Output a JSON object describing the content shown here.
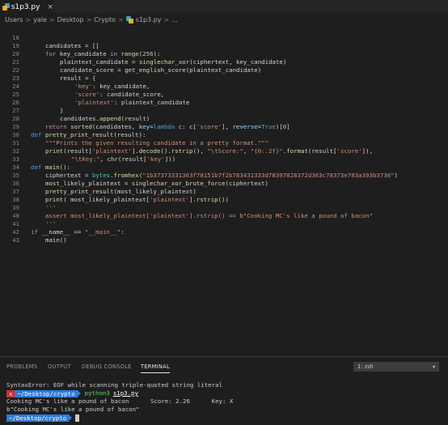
{
  "tab": {
    "label": "s1p3.py",
    "close": "×",
    "icon": "python-file-icon"
  },
  "breadcrumb": {
    "users": "Users",
    "yale": "yale",
    "desktop": "Desktop",
    "crypto": "Crypto",
    "file": "s1p3.py",
    "more": "...",
    "sep": ">"
  },
  "editor": {
    "line_numbers": [
      "18",
      "19",
      "20",
      "21",
      "22",
      "23",
      "24",
      "25",
      "26",
      "27",
      "28",
      "29",
      "30",
      "31",
      "32",
      "33",
      "34",
      "35",
      "36",
      "37",
      "38",
      "39",
      "40",
      "41",
      "42",
      "43"
    ],
    "code": {
      "l18": [
        "candidates = []"
      ],
      "l19": [
        "for",
        " key_candidate ",
        "in",
        " ",
        "range",
        "(",
        "256",
        "):"
      ],
      "l20": [
        "plaintext_candidate = ",
        "singlechar_xor",
        "(ciphertext, key_candidate)"
      ],
      "l21": [
        "candidate_score = ",
        "get_english_score",
        "(plaintext_candidate)"
      ],
      "l22": [
        "result = {"
      ],
      "l23": [
        "'key'",
        ": key_candidate,"
      ],
      "l24": [
        "'score'",
        ": candidate_score,"
      ],
      "l25": [
        "'plaintext'",
        ": plaintext_candidate"
      ],
      "l26": [
        "}"
      ],
      "l27": [
        "candidates.",
        "append",
        "(result)"
      ],
      "l28": [
        "return",
        " ",
        "sorted",
        "(candidates, ",
        "key",
        "=",
        "lambda",
        " c: c[",
        "'score'",
        "], ",
        "reverse",
        "=",
        "True",
        ")[",
        "0",
        "]"
      ],
      "l29": [
        "def",
        " ",
        "pretty_print_result",
        "(result):"
      ],
      "l30": [
        "\"\"\"Prints the given resulting candidate in a pretty format.\"\"\""
      ],
      "l31": [
        "print",
        "(result[",
        "'plaintext'",
        "].",
        "decode",
        "().",
        "rstrip",
        "(), ",
        "\"\\tScore:\"",
        ", ",
        "\"{0:.2f}\"",
        ".",
        "format",
        "(result[",
        "'score'",
        "]),"
      ],
      "l32": [
        "\"\\tKey:\"",
        ", ",
        "chr",
        "(result[",
        "'key'",
        "]))"
      ],
      "l33": [
        "def",
        " ",
        "main",
        "():"
      ],
      "l34": [
        "ciphertext = ",
        "bytes",
        ".",
        "fromhex",
        "(",
        "\"1b37373331363f78151b7f2b783431333d78397828372d363c78373e783a393b3736\"",
        ")"
      ],
      "l35": [
        "most_likely_plaintext = ",
        "singlechar_xor_brute_force",
        "(ciphertext)"
      ],
      "l36": [
        "pretty_print_result",
        "(most_likely_plaintext)"
      ],
      "l37": [
        "print",
        "( most_likely_plaintext[",
        "'plaintext'",
        "].",
        "rstrip",
        "())"
      ],
      "l38": [
        "'''"
      ],
      "l39": [
        "assert",
        " most_likely_plaintext[",
        "'plaintext'",
        "].",
        "rstrip",
        "() == ",
        "b\"Cooking MC's like a pound of bacon\""
      ],
      "l40": [
        "'''"
      ],
      "l41": [
        "if",
        " __name__ == ",
        "\"__main__\"",
        ":"
      ],
      "l42": [
        "main",
        "()"
      ],
      "l43": [
        ""
      ]
    }
  },
  "panel": {
    "tabs": [
      "PROBLEMS",
      "OUTPUT",
      "DEBUG CONSOLE",
      "TERMINAL"
    ],
    "active_tab": "TERMINAL",
    "terminal_select": "1: zsh",
    "terminal": {
      "error_line": "SyntaxError: EOF while scanning triple-quoted string literal",
      "prompt_x": "x",
      "prompt_path": "~/Desktop/crypto",
      "command": "python3",
      "command_arg": "s1p3.py",
      "output_line": "Cooking MC's like a pound of bacon      Score: 2.26      Key: X",
      "bytes_line": "b\"Cooking MC's like a pound of bacon\"",
      "prompt_path_2": "~/Desktop/crypto"
    }
  },
  "colors": {
    "keyword": "#569cd6",
    "control": "#c586c0",
    "function": "#dcdcaa",
    "string": "#ce9178",
    "number": "#b5cea8",
    "builtin_type": "#4ec9b0",
    "prompt_error": "#cc2f2f",
    "prompt_path": "#2e7bd4"
  }
}
